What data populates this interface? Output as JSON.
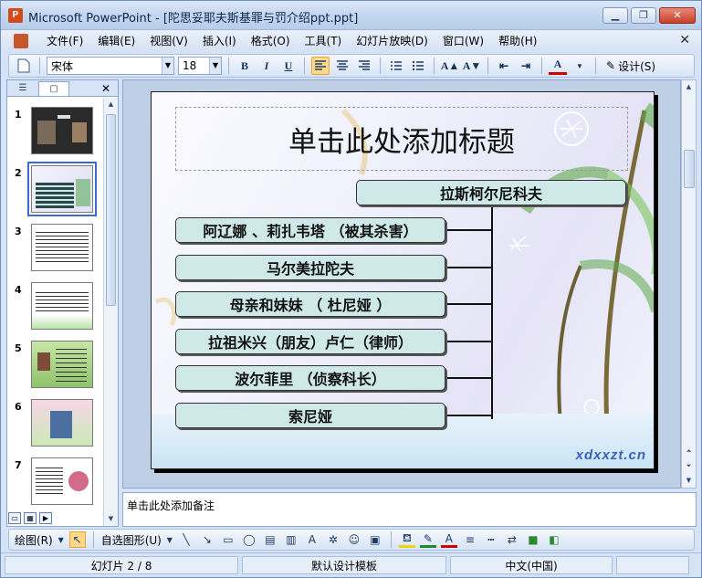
{
  "window": {
    "title": "Microsoft PowerPoint - [陀思妥耶夫斯基罪与罚介绍ppt.ppt]",
    "app_icon_text": "P",
    "buttons": {
      "minimize": "▁",
      "restore": "❐",
      "close": "✕"
    }
  },
  "menubar": {
    "items": [
      "文件(F)",
      "编辑(E)",
      "视图(V)",
      "插入(I)",
      "格式(O)",
      "工具(T)",
      "幻灯片放映(D)",
      "窗口(W)",
      "帮助(H)"
    ],
    "close_glyph": "✕"
  },
  "toolbar": {
    "font_name": "宋体",
    "font_size": "18",
    "bold": "B",
    "italic": "I",
    "underline": "U",
    "design_label": "设计(S)"
  },
  "left_panel": {
    "tab_outline": "☰",
    "tab_slides": "▢",
    "close": "✕",
    "thumbnails": [
      {
        "num": "1",
        "theme": "dark"
      },
      {
        "num": "2",
        "theme": "lavender",
        "selected": true
      },
      {
        "num": "3",
        "theme": "white-text"
      },
      {
        "num": "4",
        "theme": "white-green"
      },
      {
        "num": "5",
        "theme": "green"
      },
      {
        "num": "6",
        "theme": "pink-green"
      },
      {
        "num": "7",
        "theme": "white-pink"
      }
    ]
  },
  "slide": {
    "title_placeholder": "单击此处添加标题",
    "root_node": "拉斯柯尔尼科夫",
    "nodes": [
      "阿辽娜 、莉扎韦塔 （被其杀害）",
      "马尔美拉陀夫",
      "母亲和妹妹 （ 杜尼娅 ）",
      "拉祖米兴（朋友）卢仁（律师）",
      "波尔菲里 （侦察科长）",
      "索尼娅"
    ],
    "logo_text": "xdxxzt.cn"
  },
  "notes": {
    "placeholder": "单击此处添加备注"
  },
  "drawbar": {
    "draw_label": "绘图(R)",
    "autoshapes_label": "自选图形(U)"
  },
  "status": {
    "slide_position": "幻灯片 2 / 8",
    "template": "默认设计模板",
    "language": "中文(中国)"
  },
  "colors": {
    "node_fill": "#cfe9e9",
    "title_bar": "#c3d6ee",
    "active_button": "#ffd88a"
  }
}
